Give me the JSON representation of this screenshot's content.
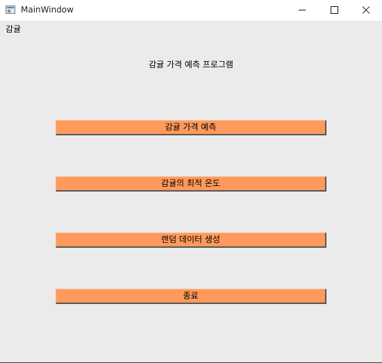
{
  "window": {
    "title": "MainWindow",
    "menu_label": "감귤",
    "heading": "감귤 가격 예측 프로그램"
  },
  "buttons": [
    {
      "label": "감귤 가격 예측"
    },
    {
      "label": "감귤의 최적 온도"
    },
    {
      "label": "랜덤 데이터 생성"
    },
    {
      "label": "종료"
    }
  ],
  "colors": {
    "button_bg": "#ff9a5c",
    "window_bg": "#ebebeb"
  },
  "icons": [
    "window-app-icon",
    "minimize-icon",
    "maximize-icon",
    "close-icon"
  ]
}
